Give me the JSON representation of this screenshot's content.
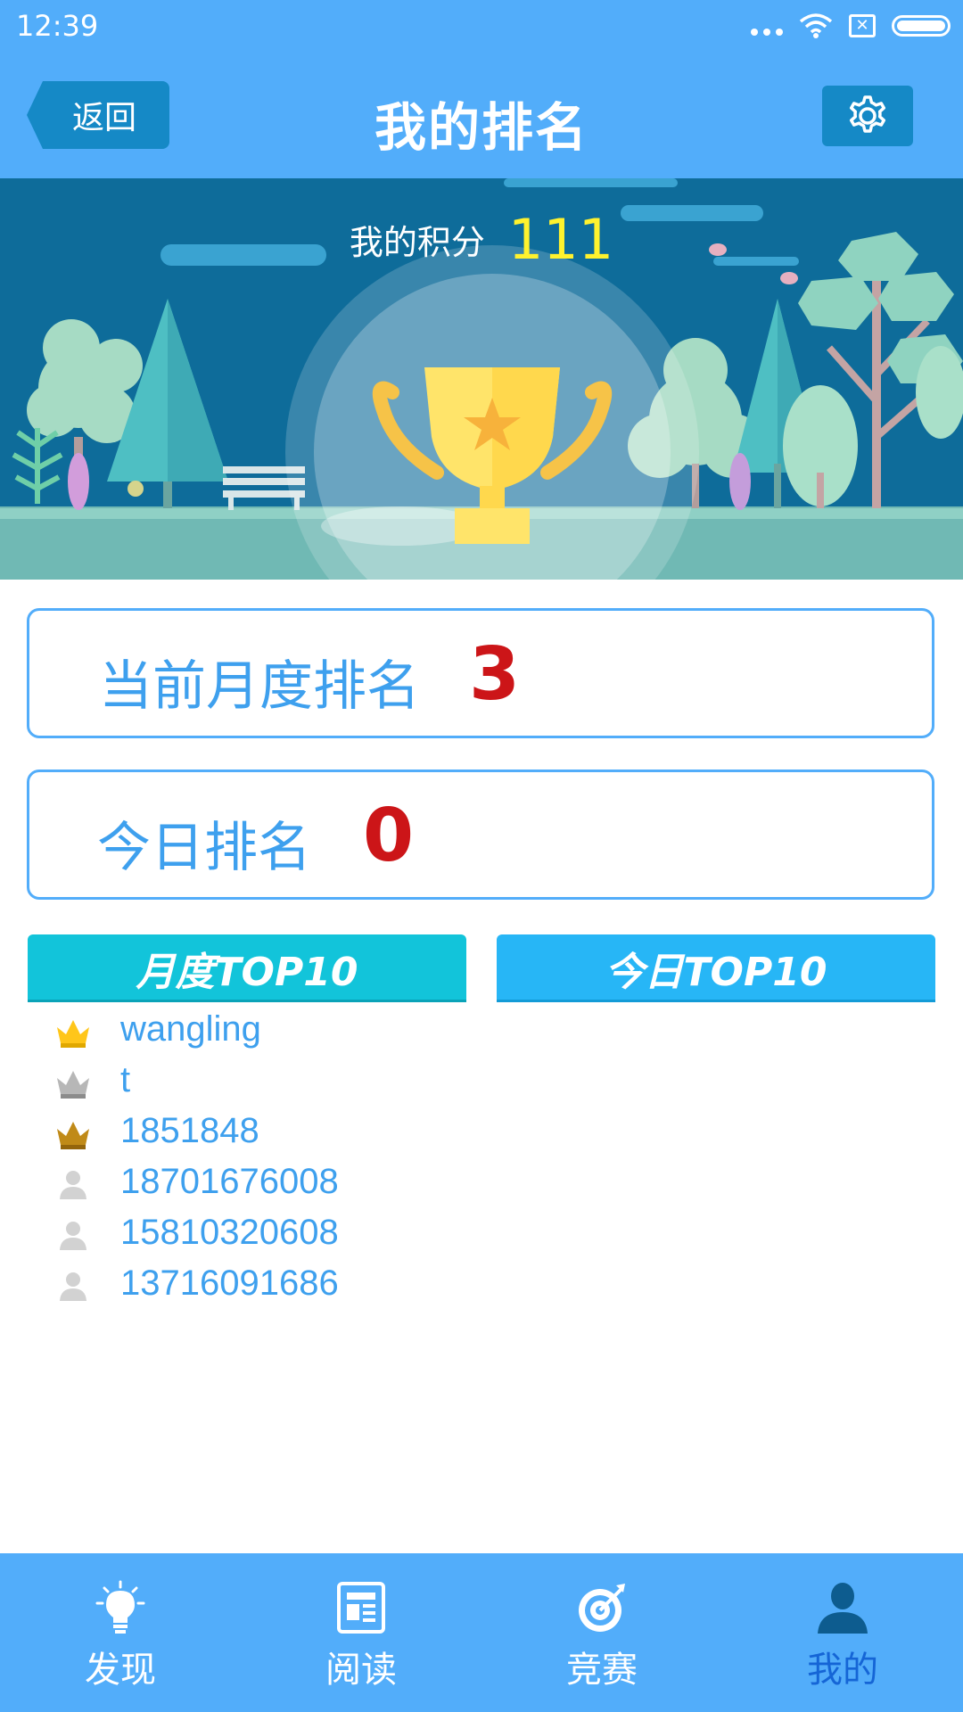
{
  "status_bar": {
    "time": "12:39"
  },
  "header": {
    "back_label": "返回",
    "title": "我的排名"
  },
  "banner": {
    "score_label": "我的积分",
    "score_value": "111"
  },
  "monthly_rank": {
    "label": "当前月度排名",
    "value": "3"
  },
  "daily_rank": {
    "label": "今日排名",
    "value": "0"
  },
  "tabs": [
    {
      "label": "月度TOP10",
      "selected": true
    },
    {
      "label": "今日TOP10",
      "selected": false
    }
  ],
  "ranking_list": [
    {
      "icon": "gold-crown-icon",
      "name": "wangling"
    },
    {
      "icon": "silver-crown-icon",
      "name": "t"
    },
    {
      "icon": "bronze-crown-icon",
      "name": "1851848"
    },
    {
      "icon": "user-icon",
      "name": "18701676008"
    },
    {
      "icon": "user-icon",
      "name": "15810320608"
    },
    {
      "icon": "user-icon",
      "name": "13716091686"
    }
  ],
  "bottom_nav": [
    {
      "label": "发现",
      "icon": "lightbulb-icon",
      "active": false
    },
    {
      "label": "阅读",
      "icon": "newspaper-icon",
      "active": false
    },
    {
      "label": "竞赛",
      "icon": "target-icon",
      "active": false
    },
    {
      "label": "我的",
      "icon": "person-icon",
      "active": true
    }
  ],
  "colors": {
    "primary": "#52adfa",
    "dark_button": "#1589c6",
    "rank_number": "#cc1518",
    "score": "#fff22e",
    "list_text": "#3ea0ee",
    "active_nav": "#1565d6"
  }
}
